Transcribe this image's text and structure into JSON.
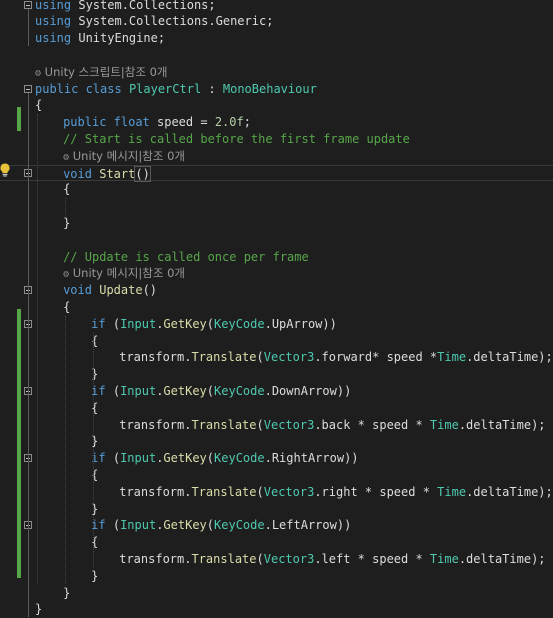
{
  "editor": {
    "usings": [
      {
        "kw": "using",
        "ns": "System.Collections;"
      },
      {
        "kw": "using",
        "ns": "System.Collections.Generic;"
      },
      {
        "kw": "using",
        "ns": "UnityEngine;"
      }
    ],
    "class_lens": "Unity 스크립트|참조 0개",
    "class_decl": {
      "mods": "public class",
      "name": "PlayerCtrl",
      "colon": " : ",
      "base": "MonoBehaviour"
    },
    "open_brace": "{",
    "close_brace": "}",
    "field": {
      "mods": "public float",
      "rest": " speed = ",
      "value": "2.0f",
      "end": ";"
    },
    "start_comment": "// Start is called before the first frame update",
    "start_lens": "Unity 메시지|참조 0개",
    "start_decl": {
      "kw": "void",
      "name": "Start",
      "parens": "()"
    },
    "update_comment": "// Update is called once per frame",
    "update_lens": "Unity 메시지|참조 0개",
    "update_decl": {
      "kw": "void",
      "name": "Update",
      "parens": "()"
    },
    "input_class": "Input",
    "getkey": "GetKey",
    "keycode": "KeyCode",
    "blocks": [
      {
        "key": "UpArrow",
        "dir": "forward",
        "tail": "* speed *"
      },
      {
        "key": "DownArrow",
        "dir": "back",
        "tail": " * speed * "
      },
      {
        "key": "RightArrow",
        "dir": "right",
        "tail": " * speed * "
      },
      {
        "key": "LeftArrow",
        "dir": "left",
        "tail": " * speed * "
      }
    ],
    "if_kw": "if",
    "transform": "transform",
    "translate": "Translate",
    "vector3": "Vector3",
    "time_class": "Time",
    "deltatime": "deltaTime",
    "colors": {
      "background": "#1e1e1e",
      "keyword": "#569cd6",
      "type": "#4ec9b0",
      "comment": "#57a64a",
      "number": "#b5cea8",
      "method": "#dcdcaa",
      "change_bar": "#57a64a"
    },
    "icons": [
      "collapse-icon",
      "lightbulb-icon",
      "unity-icon"
    ]
  }
}
